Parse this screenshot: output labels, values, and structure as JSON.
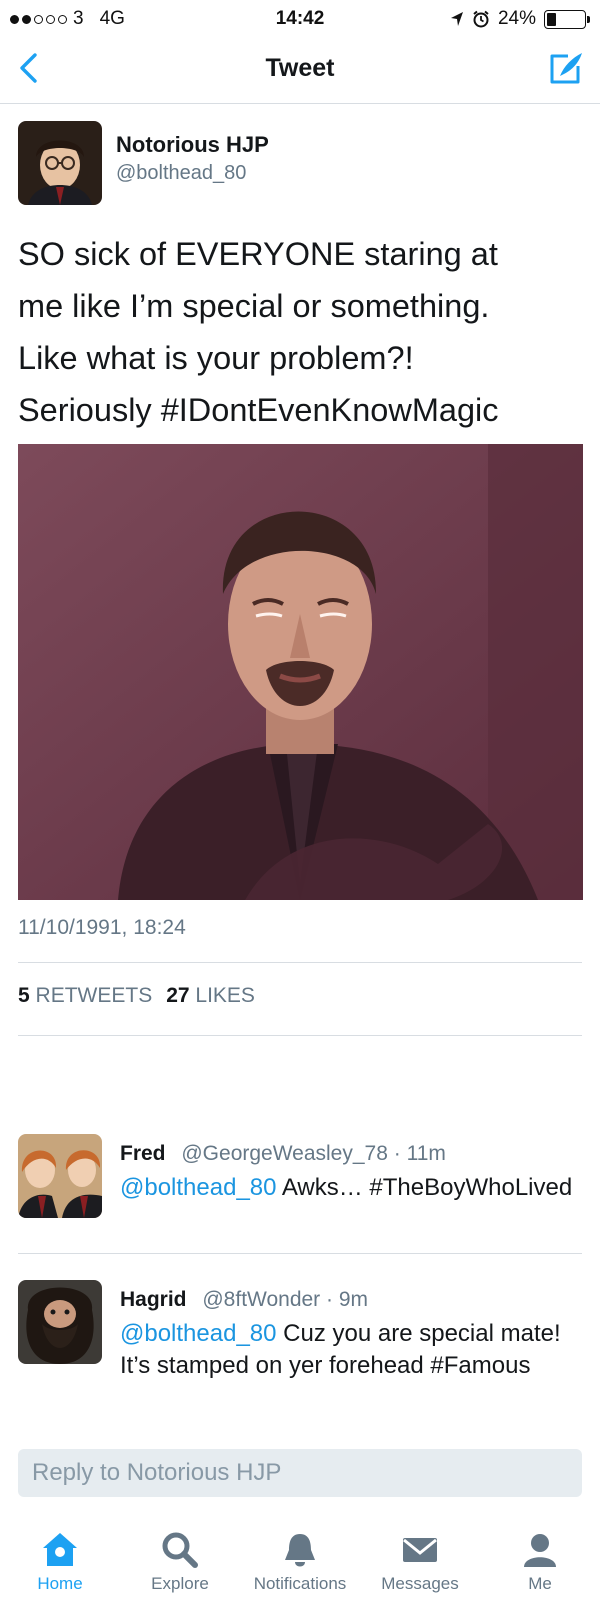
{
  "status_bar": {
    "carrier": "3",
    "network": "4G",
    "time": "14:42",
    "battery": "24%",
    "battery_level": 0.24
  },
  "nav": {
    "title": "Tweet"
  },
  "tweet": {
    "author_name": "Notorious HJP",
    "author_handle": "@bolthead_80",
    "text_lines": [
      "SO sick of EVERYONE staring at",
      "me like I’m special or something.",
      "Like what is your problem?!",
      "Seriously #IDontEvenKnowMagic"
    ],
    "timestamp": "11/10/1991, 18:24",
    "retweets_count": "5",
    "retweets_label": "RETWEETS",
    "likes_count": "27",
    "likes_label": "LIKES"
  },
  "replies": [
    {
      "name": "Fred",
      "handle": "@GeorgeWeasley_78",
      "time": "· 11m",
      "mention": "@bolthead_80",
      "text": " Awks… #TheBoyWhoLived"
    },
    {
      "name": "Hagrid",
      "handle": "@8ftWonder",
      "time": "· 9m",
      "mention": "@bolthead_80",
      "text": " Cuz you are special mate! It’s stamped on yer forehead #Famous"
    }
  ],
  "reply_box": {
    "placeholder": "Reply to Notorious HJP"
  },
  "tabs": [
    {
      "label": "Home",
      "icon": "home-icon",
      "active": true
    },
    {
      "label": "Explore",
      "icon": "search-icon",
      "active": false
    },
    {
      "label": "Notifications",
      "icon": "bell-icon",
      "active": false
    },
    {
      "label": "Messages",
      "icon": "envelope-icon",
      "active": false
    },
    {
      "label": "Me",
      "icon": "person-icon",
      "active": false
    }
  ],
  "colors": {
    "accent": "#1da1f2",
    "link": "#1b95e0",
    "secondary_text": "#657786",
    "primary_text": "#14171a",
    "image_tint": "#6e3a4c"
  }
}
